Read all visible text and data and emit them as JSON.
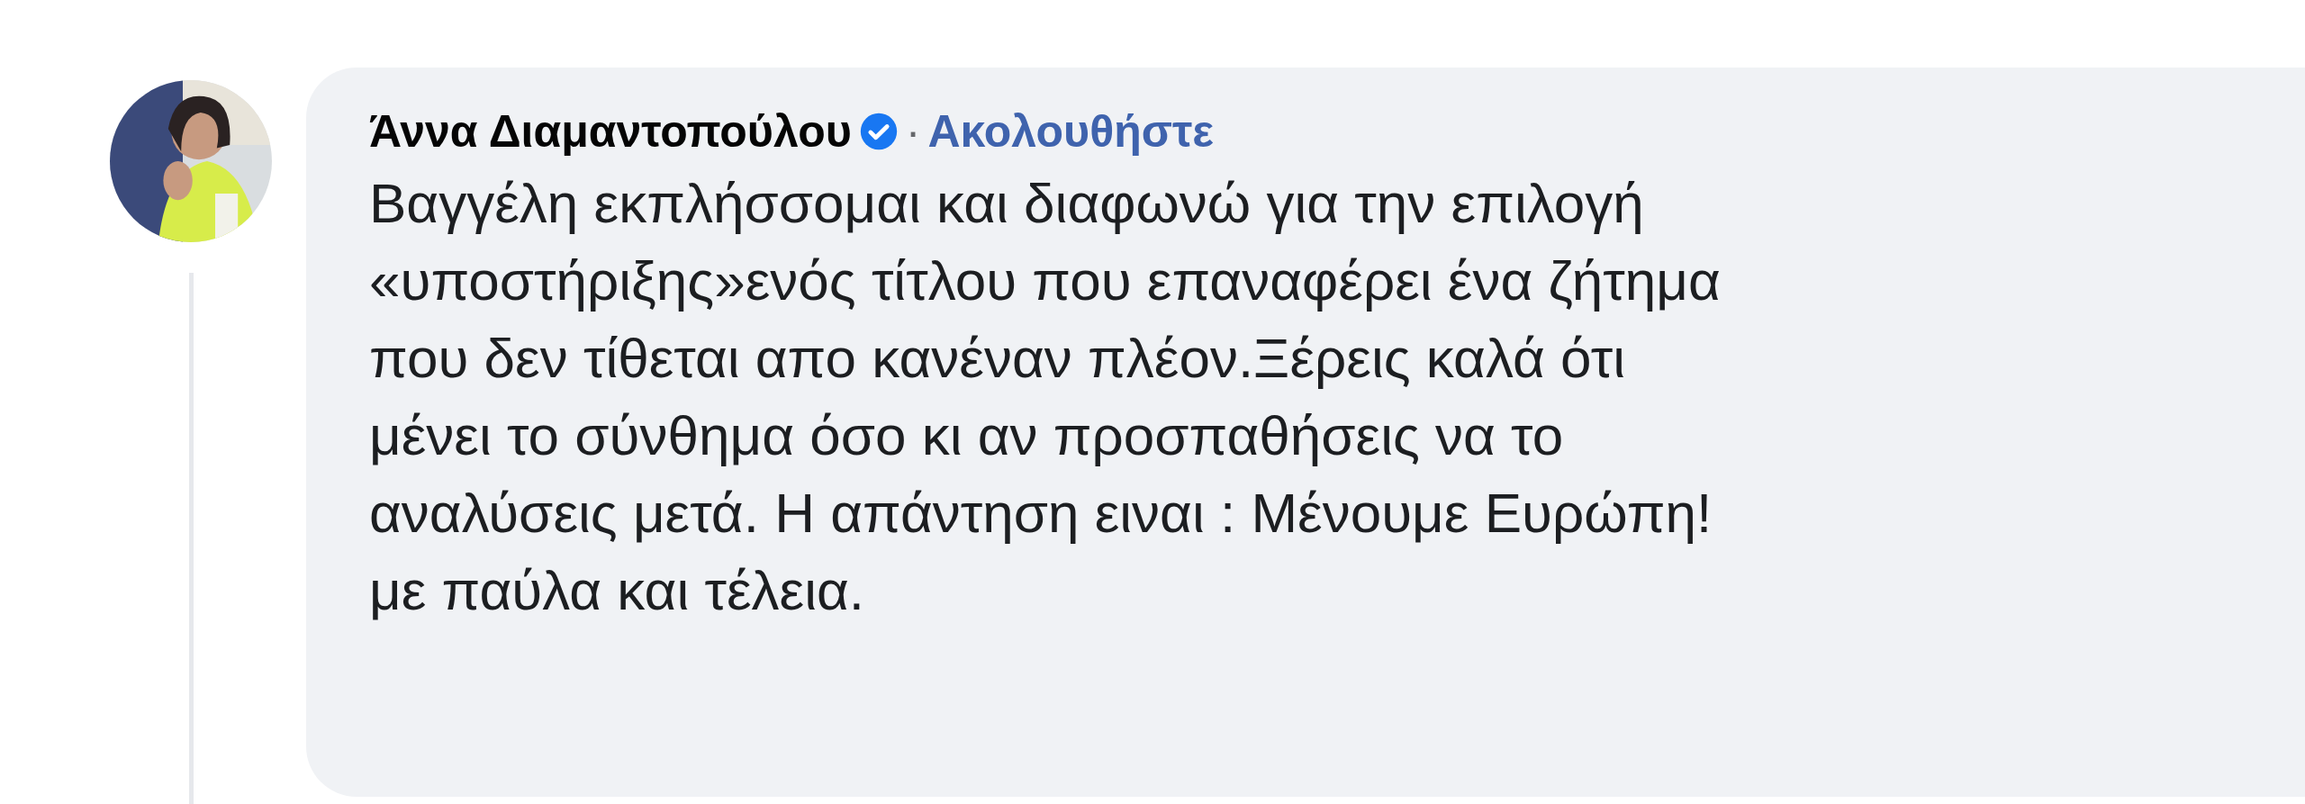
{
  "comment": {
    "author": "Άννα Διαμαντοπούλου",
    "verified": true,
    "separator": "·",
    "follow_link": "Ακολουθήστε",
    "text": "Βαγγέλη εκπλήσσομαι και διαφωνώ για την επιλογή\n«υποστήριξης»ενός τίτλου που επαναφέρει ένα ζήτημα\nπου δεν τίθεται απο κανέναν πλέον.Ξέρεις καλά ότι\nμένει το σύνθημα όσο κι αν προσπαθήσεις να το\nαναλύσεις μετά. Η απάντηση ειναι : Μένουμε Ευρώπη!\nμε παύλα και τέλεια."
  }
}
